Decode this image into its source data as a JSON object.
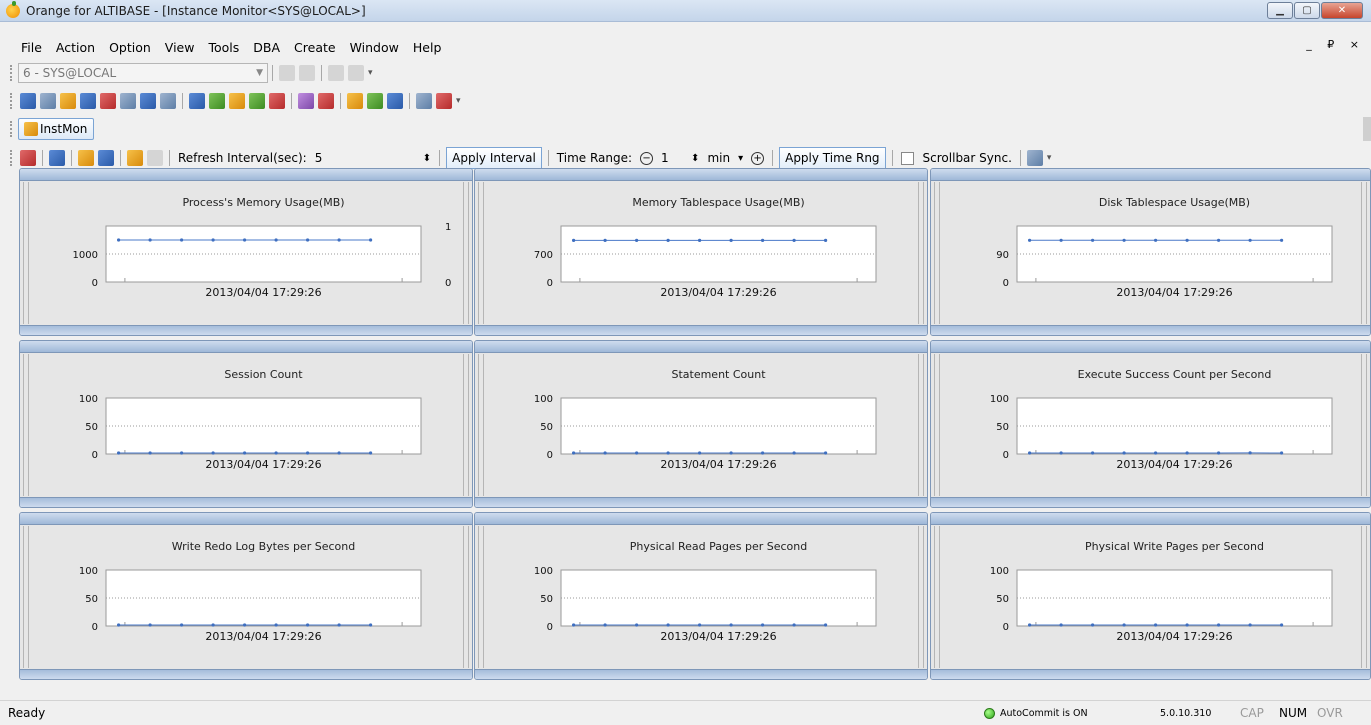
{
  "window": {
    "title": "Orange for ALTIBASE - [Instance Monitor<SYS@LOCAL>]"
  },
  "menu": [
    "File",
    "Action",
    "Option",
    "View",
    "Tools",
    "DBA",
    "Create",
    "Window",
    "Help"
  ],
  "mdi_controls": "_ ₽ ×",
  "connection": {
    "selected": "6 - SYS@LOCAL"
  },
  "tab": {
    "label": "InstMon"
  },
  "monitor_toolbar": {
    "refresh_label": "Refresh Interval(sec):",
    "refresh_value": "5",
    "apply_interval": "Apply Interval",
    "time_range_label": "Time Range:",
    "time_range_value": "1",
    "time_unit": "min",
    "apply_time_rng": "Apply Time Rng",
    "scrollbar_sync": "Scrollbar Sync."
  },
  "status": {
    "ready": "Ready",
    "autocommit": "AutoCommit is ON",
    "version": "5.0.10.310",
    "cap": "CAP",
    "num": "NUM",
    "ovr": "OVR"
  },
  "chart_data": [
    {
      "type": "line",
      "title": "Process's Memory Usage(MB)",
      "xlabel": "2013/04/04 17:29:26",
      "y_ticks": [
        "1000",
        "0"
      ],
      "y2_ticks": [
        "1",
        "0"
      ],
      "ylim": [
        0,
        2000
      ],
      "series": [
        {
          "values": [
            1500,
            1500,
            1500,
            1500,
            1500,
            1500,
            1500,
            1500,
            1500
          ]
        }
      ]
    },
    {
      "type": "line",
      "title": "Memory Tablespace Usage(MB)",
      "xlabel": "2013/04/04 17:29:26",
      "y_ticks": [
        "700",
        "0"
      ],
      "ylim": [
        0,
        1400
      ],
      "series": [
        {
          "values": [
            1040,
            1040,
            1040,
            1040,
            1040,
            1040,
            1040,
            1040,
            1040
          ]
        }
      ]
    },
    {
      "type": "line",
      "title": "Disk Tablespace Usage(MB)",
      "xlabel": "2013/04/04 17:29:26",
      "y_ticks": [
        "90",
        "0"
      ],
      "ylim": [
        0,
        180
      ],
      "series": [
        {
          "values": [
            134,
            134,
            134,
            134,
            134,
            134,
            134,
            134,
            134
          ]
        }
      ]
    },
    {
      "type": "line",
      "title": "Session Count",
      "xlabel": "2013/04/04 17:29:26",
      "y_ticks": [
        "100",
        "50",
        "0"
      ],
      "ylim": [
        0,
        100
      ],
      "series": [
        {
          "values": [
            1,
            1,
            1,
            1,
            1,
            1,
            1,
            1,
            1
          ]
        }
      ]
    },
    {
      "type": "line",
      "title": "Statement Count",
      "xlabel": "2013/04/04 17:29:26",
      "y_ticks": [
        "100",
        "50",
        "0"
      ],
      "ylim": [
        0,
        100
      ],
      "series": [
        {
          "values": [
            1,
            1,
            1,
            1,
            1,
            1,
            1,
            1,
            1
          ]
        }
      ]
    },
    {
      "type": "line",
      "title": "Execute Success Count per Second",
      "xlabel": "2013/04/04 17:29:26",
      "y_ticks": [
        "100",
        "50",
        "0"
      ],
      "ylim": [
        0,
        100
      ],
      "series": [
        {
          "values": [
            0,
            0,
            0,
            0,
            0,
            0,
            0,
            2,
            0
          ]
        }
      ]
    },
    {
      "type": "line",
      "title": "Write Redo Log Bytes per Second",
      "xlabel": "2013/04/04 17:29:26",
      "y_ticks": [
        "100",
        "50",
        "0"
      ],
      "ylim": [
        0,
        100
      ],
      "series": [
        {
          "values": [
            0,
            0,
            0,
            0,
            0,
            0,
            0,
            0,
            0
          ]
        }
      ]
    },
    {
      "type": "line",
      "title": "Physical Read Pages per Second",
      "xlabel": "2013/04/04 17:29:26",
      "y_ticks": [
        "100",
        "50",
        "0"
      ],
      "ylim": [
        0,
        100
      ],
      "series": [
        {
          "values": [
            0,
            0,
            0,
            0,
            0,
            0,
            0,
            0,
            0
          ]
        }
      ]
    },
    {
      "type": "line",
      "title": "Physical Write Pages per Second",
      "xlabel": "2013/04/04 17:29:26",
      "y_ticks": [
        "100",
        "50",
        "0"
      ],
      "ylim": [
        0,
        100
      ],
      "series": [
        {
          "values": [
            0,
            0,
            0,
            0,
            0,
            0,
            0,
            0,
            0
          ]
        }
      ]
    }
  ]
}
